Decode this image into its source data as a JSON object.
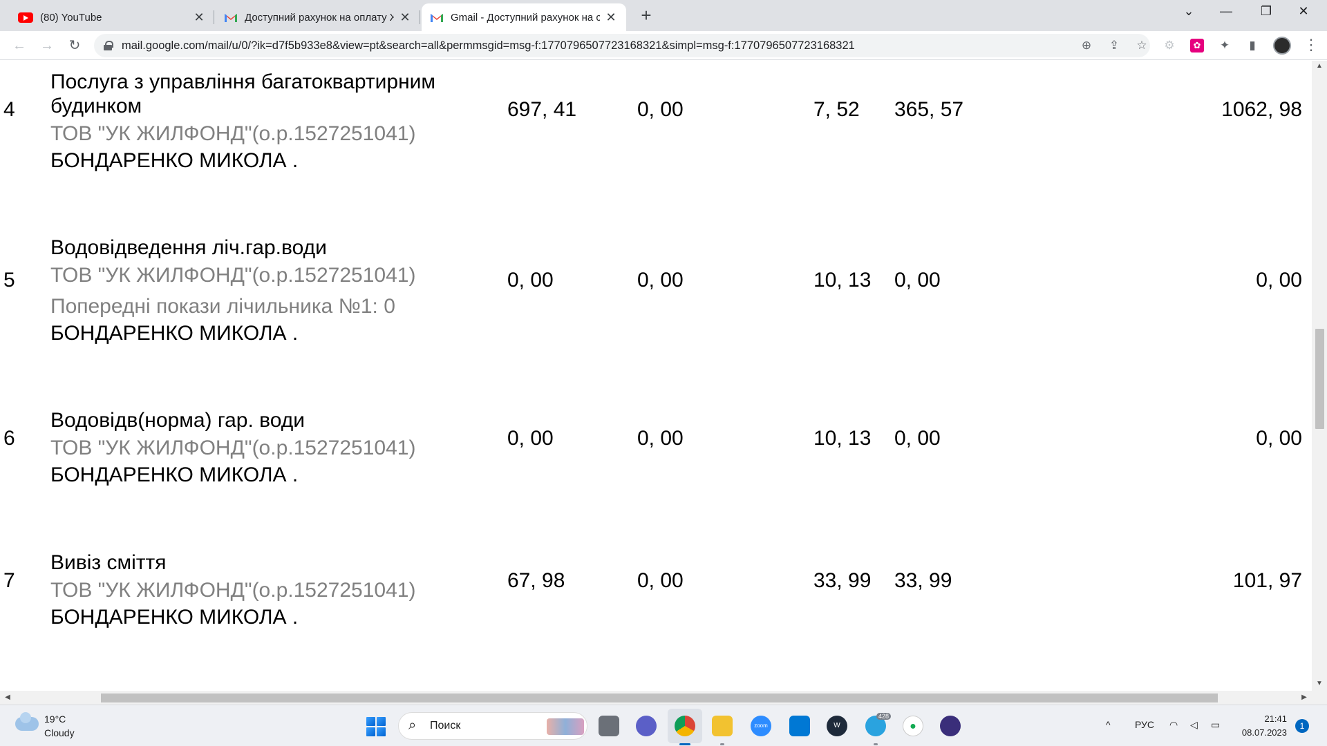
{
  "tabs": [
    {
      "title": "(80) YouTube",
      "icon": "youtube-icon"
    },
    {
      "title": "Доступний рахунок на оплату Ж",
      "icon": "gmail-icon"
    },
    {
      "title": "Gmail - Доступний рахунок на с",
      "icon": "gmail-icon",
      "active": true
    }
  ],
  "new_tab_label": "+",
  "window_controls": {
    "tab_search": "⌄",
    "minimize": "—",
    "restore": "❐",
    "close": "✕"
  },
  "toolbar": {
    "back": "←",
    "forward": "→",
    "reload": "↻",
    "url": "mail.google.com/mail/u/0/?ik=d7f5b933e8&view=pt&search=all&permmsgid=msg-f:1770796507723168321&simpl=msg-f:1770796507723168321",
    "zoom": "⊕",
    "share": "⇪",
    "bookmark": "☆",
    "extensions": "✦",
    "sidepanel": "▮",
    "menu": "⋮"
  },
  "rows": [
    {
      "index": "4",
      "service_line1": "Послуга з управління багатоквартирним",
      "service_line2": "будинком",
      "provider": "ТОВ \"УК ЖИЛФОНД\"(о.р.1527251041)",
      "note": "",
      "person": "БОНДАРЕНКО МИКОЛА .",
      "col1": "697, 41",
      "col2": "0, 00",
      "col3": "7, 52",
      "col4": "365, 57",
      "total": "1062, 98"
    },
    {
      "index": "5",
      "service_line1": "Водовідведення ліч.гар.води",
      "service_line2": "",
      "provider": "ТОВ \"УК ЖИЛФОНД\"(о.р.1527251041)",
      "note": "Попередні покази лічильника №1: 0",
      "person": "БОНДАРЕНКО МИКОЛА .",
      "col1": "0, 00",
      "col2": "0, 00",
      "col3": "10, 13",
      "col4": "0, 00",
      "total": "0, 00"
    },
    {
      "index": "6",
      "service_line1": "Водовідв(норма) гар. води",
      "service_line2": "",
      "provider": "ТОВ \"УК ЖИЛФОНД\"(о.р.1527251041)",
      "note": "",
      "person": "БОНДАРЕНКО МИКОЛА .",
      "col1": "0, 00",
      "col2": "0, 00",
      "col3": "10, 13",
      "col4": "0, 00",
      "total": "0, 00"
    },
    {
      "index": "7",
      "service_line1": "Вивіз сміття",
      "service_line2": "",
      "provider": "ТОВ \"УК ЖИЛФОНД\"(о.р.1527251041)",
      "note": "",
      "person": "БОНДАРЕНКО МИКОЛА .",
      "col1": "67, 98",
      "col2": "0, 00",
      "col3": "33, 99",
      "col4": "33, 99",
      "total": "101, 97"
    }
  ],
  "taskbar": {
    "weather_temp": "19°C",
    "weather_condition": "Cloudy",
    "search_label": "Поиск",
    "telegram_badge": "428",
    "tray_chevron": "^",
    "language": "РУС",
    "time": "21:41",
    "date": "08.07.2023",
    "notifications": "1"
  }
}
